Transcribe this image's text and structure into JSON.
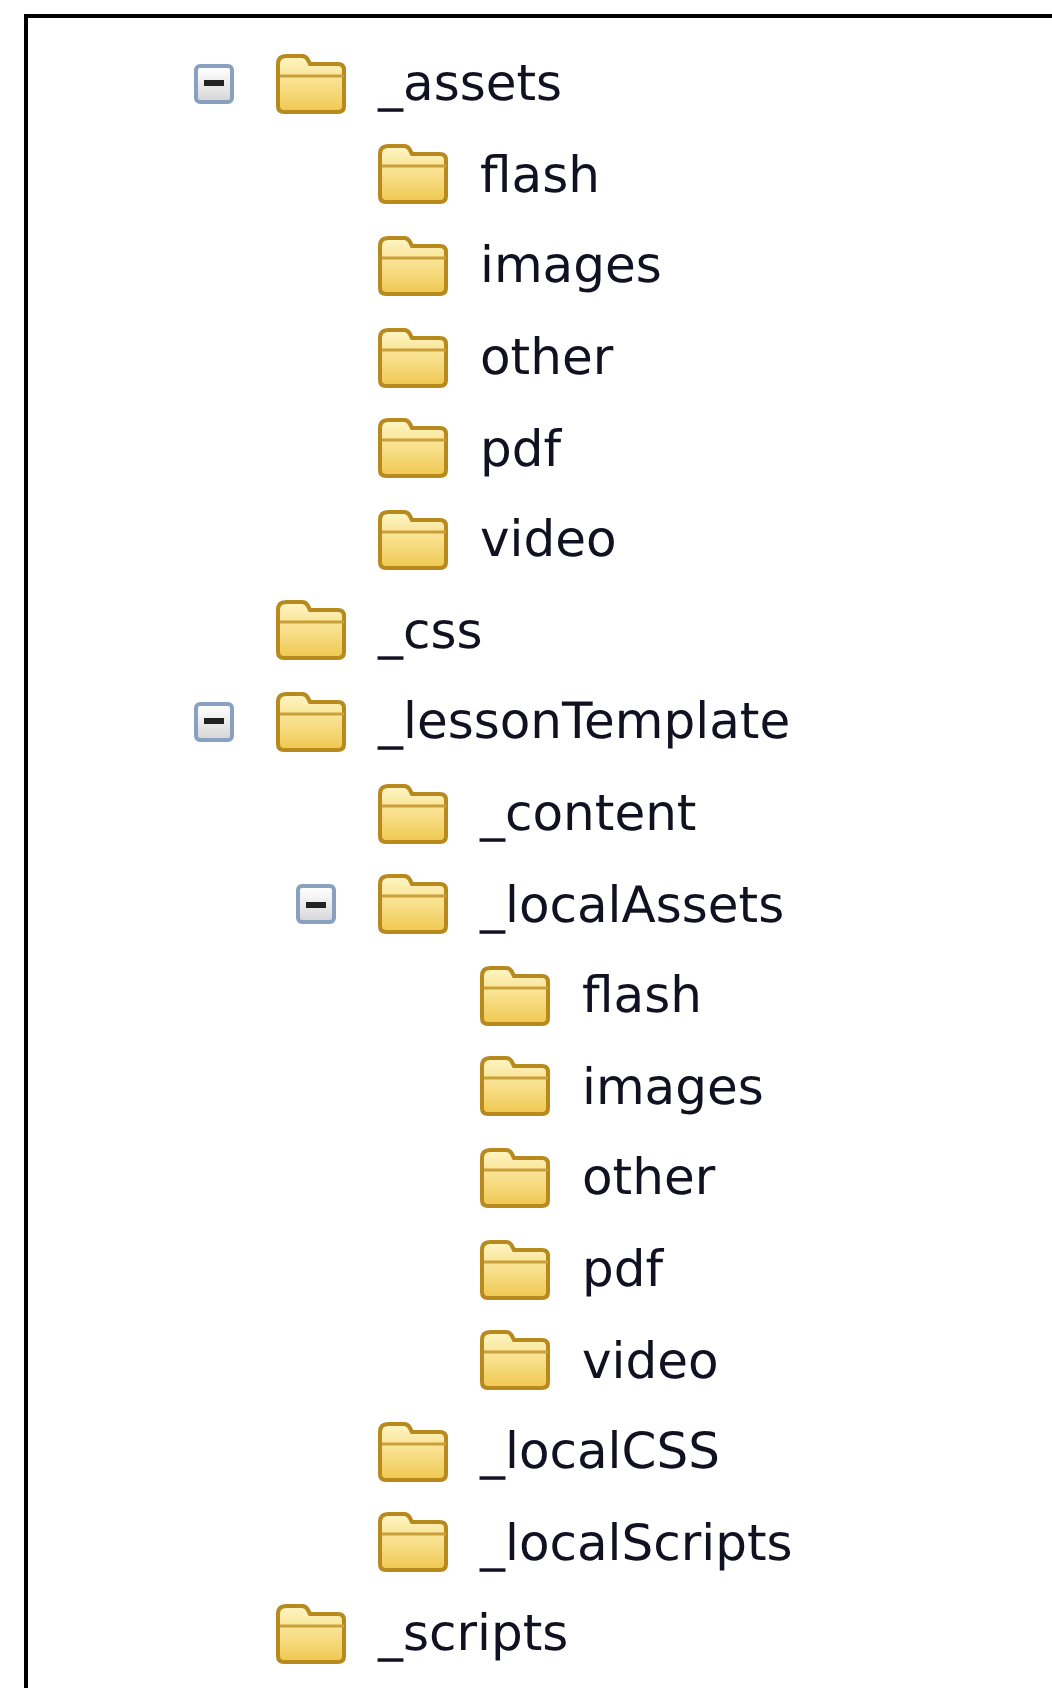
{
  "tree": [
    {
      "label": "_assets",
      "expanded": true,
      "children": [
        {
          "label": "flash"
        },
        {
          "label": "images"
        },
        {
          "label": "other"
        },
        {
          "label": "pdf"
        },
        {
          "label": "video"
        }
      ]
    },
    {
      "label": "_css"
    },
    {
      "label": "_lessonTemplate",
      "expanded": true,
      "children": [
        {
          "label": "_content"
        },
        {
          "label": "_localAssets",
          "expanded": true,
          "children": [
            {
              "label": "flash"
            },
            {
              "label": "images"
            },
            {
              "label": "other"
            },
            {
              "label": "pdf"
            },
            {
              "label": "video"
            }
          ]
        },
        {
          "label": "_localCSS"
        },
        {
          "label": "_localScripts"
        }
      ]
    },
    {
      "label": "_scripts"
    }
  ]
}
